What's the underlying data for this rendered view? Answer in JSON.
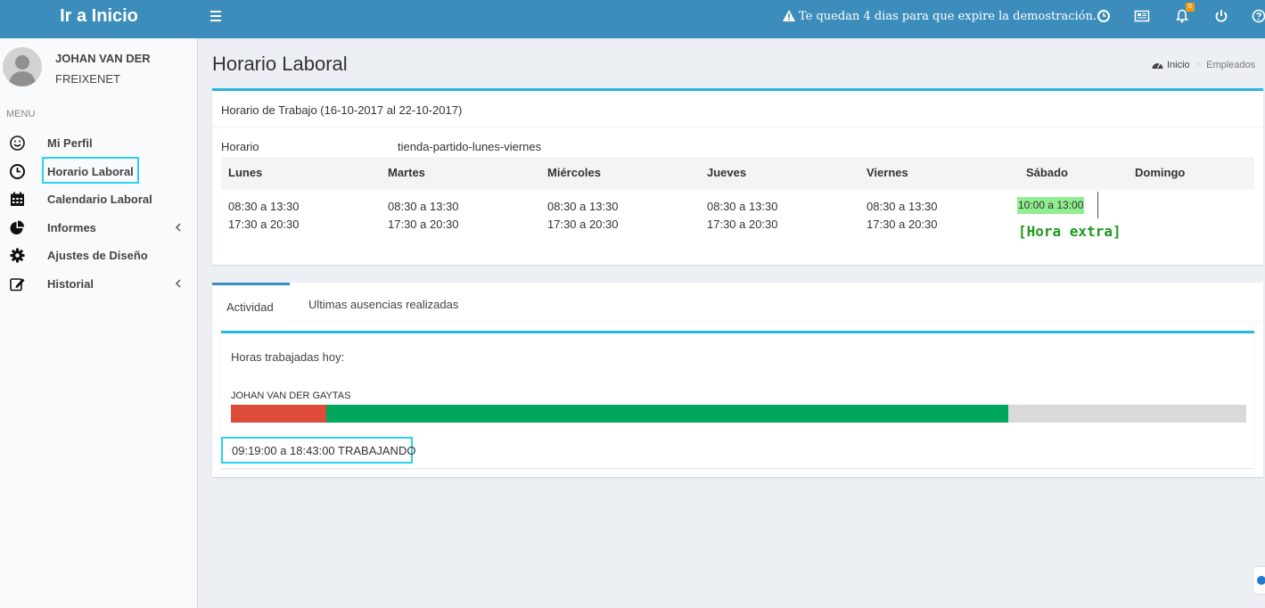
{
  "header": {
    "logo_text": "Ir a Inicio",
    "demo_notice": "Te quedan 4 dias para que expire la demostración.",
    "notification_count": "0",
    "icons": [
      "clock-icon",
      "newspaper-icon",
      "bell-icon",
      "power-icon",
      "help-icon"
    ]
  },
  "sidebar": {
    "user_name": "JOHAN VAN DER",
    "user_company": "FREIXENET",
    "menu_header": "MENU",
    "items": [
      {
        "label": "Mi Perfil",
        "icon": "smile-icon"
      },
      {
        "label": "Horario Laboral",
        "icon": "clock-icon",
        "active": true
      },
      {
        "label": "Calendario Laboral",
        "icon": "calendar-icon"
      },
      {
        "label": "Informes",
        "icon": "pie-chart-icon",
        "has_submenu": true
      },
      {
        "label": "Ajustes de Diseño",
        "icon": "gear-icon"
      },
      {
        "label": "Historial",
        "icon": "edit-icon",
        "has_submenu": true
      }
    ]
  },
  "page": {
    "title": "Horario Laboral",
    "breadcrumb": [
      "Inicio",
      "Empleados"
    ]
  },
  "schedule": {
    "title": "Horario de Trabajo (16-10-2017 al 22-10-2017)",
    "horario_label": "Horario",
    "horario_value": "tienda-partido-lunes-viernes",
    "days": [
      {
        "name": "Lunes",
        "slots": [
          "08:30 a 13:30",
          "17:30 a 20:30"
        ]
      },
      {
        "name": "Martes",
        "slots": [
          "08:30 a 13:30",
          "17:30 a 20:30"
        ]
      },
      {
        "name": "Miércoles",
        "slots": [
          "08:30 a 13:30",
          "17:30 a 20:30"
        ]
      },
      {
        "name": "Jueves",
        "slots": [
          "08:30 a 13:30",
          "17:30 a 20:30"
        ]
      },
      {
        "name": "Viernes",
        "slots": [
          "08:30 a 13:30",
          "17:30 a 20:30"
        ]
      },
      {
        "name": "Sábado",
        "slots": [
          "10:00 a 13:00"
        ],
        "extra_label": "[Hora extra]"
      },
      {
        "name": "Domingo",
        "slots": []
      }
    ],
    "extra_highlight_color": "#90ee90",
    "extra_label_color": "#1e9a1e"
  },
  "activity": {
    "tabs": [
      "Actividad",
      "Ultimas ausencias realizadas"
    ],
    "hours_title": "Horas trabajadas hoy:",
    "employee": "JOHAN VAN DER GAYTAS",
    "bar": {
      "red_fraction": 0.094,
      "green_fraction": 0.672,
      "colors": {
        "red": "#dd4b39",
        "green": "#00a65a",
        "track": "#d9d9d9"
      }
    },
    "status": "09:19:00 a 18:43:00 TRABAJANDO"
  },
  "colors": {
    "header": "#3c8dbc",
    "box_accent": "#29b6e0",
    "highlight_outline": "#29d3ee"
  }
}
